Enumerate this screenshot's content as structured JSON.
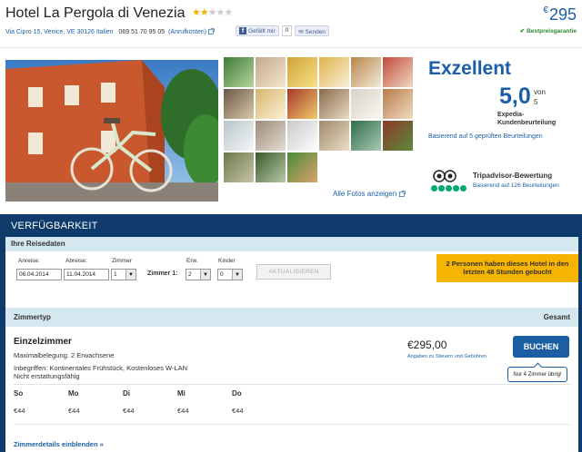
{
  "hotel": {
    "name": "Hotel La Pergola di Venezia",
    "stars": 2,
    "stars_max": 5,
    "address": "Via Cipro 15, Venice, VE 30126 Italien",
    "phone": "069 51 70 95 05",
    "phone_cost": "(Anrufkosten)"
  },
  "social": {
    "like_label": "Gefällt mir",
    "like_count": "0",
    "send_label": "Senden"
  },
  "price": {
    "currency": "€",
    "amount": "295",
    "guarantee": "Bestpreisgarantie"
  },
  "gallery": {
    "all_photos": "Alle Fotos anzeigen"
  },
  "rating": {
    "word": "Exzellent",
    "score": "5,0",
    "von": "von",
    "max": "5",
    "label_line1": "Expedia-",
    "label_line2": "Kundenbeurteilung",
    "based_on": "Basierend auf 5 geprüften Beurteilungen"
  },
  "tripadvisor": {
    "title": "Tripadvisor-Bewertung",
    "based_on": "Basierend auf 126 Beurteilungen"
  },
  "availability": {
    "title": "VERFÜGBARKEIT",
    "dates_heading": "Ihre Reisedaten",
    "checkin_label": "Anreise:",
    "checkin_value": "06.04.2014",
    "checkout_label": "Abreise:",
    "checkout_value": "11.04.2014",
    "rooms_label": "Zimmer",
    "rooms_value": "1",
    "room1_label": "Zimmer 1:",
    "adults_label": "Erw.",
    "adults_value": "2",
    "children_label": "Kinder",
    "children_value": "0",
    "update_button": "AKTUALISIEREN",
    "alert": "2 Personen haben dieses Hotel in den letzten 48 Stunden gebucht"
  },
  "room_table": {
    "col_type": "Zimmertyp",
    "col_total": "Gesamt",
    "room": {
      "name": "Einzelzimmer",
      "occupancy": "Maximalbelegung: 2 Erwachsene",
      "inclusive": "Inbegriffen: Kontinentales Frühstück, Kostenloses W-LAN",
      "refund": "Nicht erstattungsfähig",
      "price": "€295,00",
      "tax_note": "Angaben zu Steuern und Gebühren",
      "book_button": "BUCHEN",
      "remaining": "Nur 4 Zimmer übrig!"
    },
    "days": [
      {
        "day": "So",
        "price": "€44"
      },
      {
        "day": "Mo",
        "price": "€44"
      },
      {
        "day": "Di",
        "price": "€44"
      },
      {
        "day": "Mi",
        "price": "€44"
      },
      {
        "day": "Do",
        "price": "€44"
      }
    ],
    "details_link": "Zimmerdetails einblenden »"
  },
  "colors": {
    "brand_blue": "#1a5fa8",
    "header_navy": "#0e3a6c",
    "alert_yellow": "#f5b400",
    "guarantee_green": "#2d8a2d"
  }
}
